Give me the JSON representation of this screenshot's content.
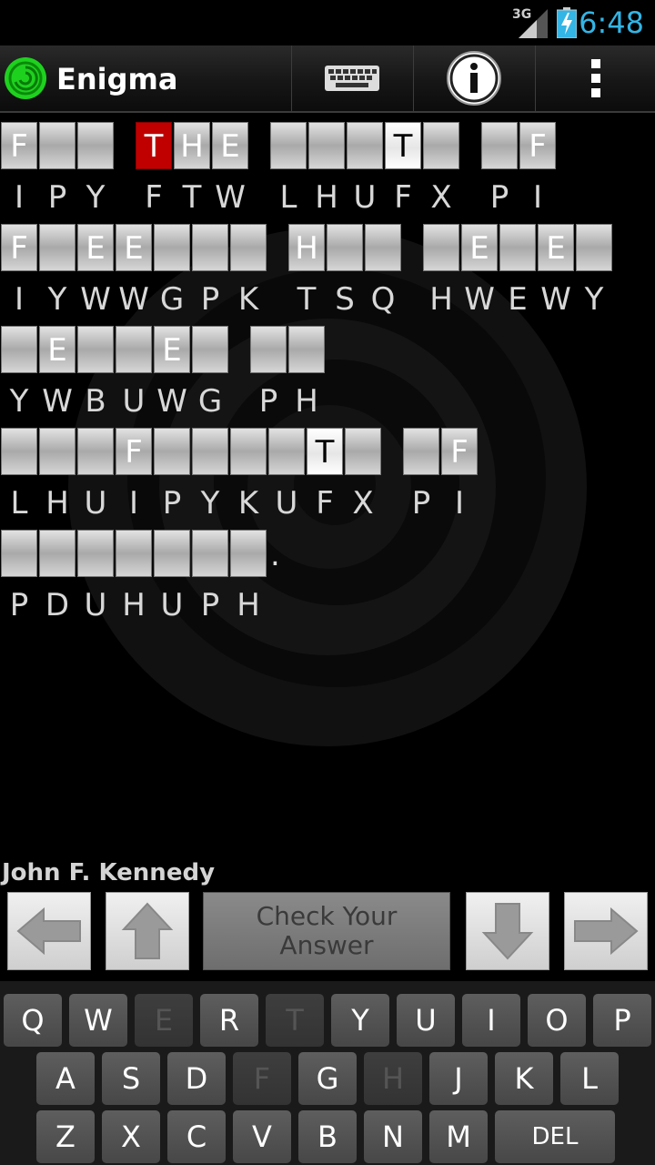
{
  "status_bar": {
    "network": "3G",
    "time": "6:48"
  },
  "action_bar": {
    "title": "Enigma",
    "keyboard_icon": "keyboard-icon",
    "info_icon": "info-icon",
    "overflow_icon": "overflow-menu-icon"
  },
  "puzzle": {
    "lines": [
      {
        "words": [
          {
            "slots": [
              {
                "l": "F",
                "c": "I"
              },
              {
                "l": "",
                "c": "P"
              },
              {
                "l": "",
                "c": "Y"
              }
            ]
          },
          {
            "slots": [
              {
                "l": "T",
                "c": "F",
                "state": "selected"
              },
              {
                "l": "H",
                "c": "T"
              },
              {
                "l": "E",
                "c": "W"
              }
            ]
          },
          {
            "slots": [
              {
                "l": "",
                "c": "L"
              },
              {
                "l": "",
                "c": "H"
              },
              {
                "l": "",
                "c": "U"
              },
              {
                "l": "T",
                "c": "F",
                "state": "current"
              },
              {
                "l": "",
                "c": "X"
              }
            ]
          },
          {
            "slots": [
              {
                "l": "",
                "c": "P"
              },
              {
                "l": "F",
                "c": "I"
              }
            ]
          }
        ]
      },
      {
        "words": [
          {
            "slots": [
              {
                "l": "F",
                "c": "I"
              },
              {
                "l": "",
                "c": "Y"
              },
              {
                "l": "E",
                "c": "W"
              },
              {
                "l": "E",
                "c": "W"
              },
              {
                "l": "",
                "c": "G"
              },
              {
                "l": "",
                "c": "P"
              },
              {
                "l": "",
                "c": "K"
              }
            ]
          },
          {
            "slots": [
              {
                "l": "H",
                "c": "T"
              },
              {
                "l": "",
                "c": "S"
              },
              {
                "l": "",
                "c": "Q"
              }
            ]
          },
          {
            "slots": [
              {
                "l": "",
                "c": "H"
              },
              {
                "l": "E",
                "c": "W"
              },
              {
                "l": "",
                "c": "E"
              },
              {
                "l": "E",
                "c": "W"
              },
              {
                "l": "",
                "c": "Y"
              }
            ]
          }
        ]
      },
      {
        "words": [
          {
            "slots": [
              {
                "l": "",
                "c": "Y"
              },
              {
                "l": "E",
                "c": "W"
              },
              {
                "l": "",
                "c": "B"
              },
              {
                "l": "",
                "c": "U"
              },
              {
                "l": "E",
                "c": "W"
              },
              {
                "l": "",
                "c": "G"
              }
            ]
          },
          {
            "slots": [
              {
                "l": "",
                "c": "P"
              },
              {
                "l": "",
                "c": "H"
              }
            ]
          }
        ]
      },
      {
        "words": [
          {
            "slots": [
              {
                "l": "",
                "c": "L"
              },
              {
                "l": "",
                "c": "H"
              },
              {
                "l": "",
                "c": "U"
              },
              {
                "l": "F",
                "c": "I"
              },
              {
                "l": "",
                "c": "P"
              },
              {
                "l": "",
                "c": "Y"
              },
              {
                "l": "",
                "c": "K"
              },
              {
                "l": "",
                "c": "U"
              },
              {
                "l": "T",
                "c": "F",
                "state": "current"
              },
              {
                "l": "",
                "c": "X"
              }
            ]
          },
          {
            "slots": [
              {
                "l": "",
                "c": "P"
              },
              {
                "l": "F",
                "c": "I"
              }
            ]
          }
        ]
      },
      {
        "words": [
          {
            "slots": [
              {
                "l": "",
                "c": "P"
              },
              {
                "l": "",
                "c": "D"
              },
              {
                "l": "",
                "c": "U"
              },
              {
                "l": "",
                "c": "H"
              },
              {
                "l": "",
                "c": "U"
              },
              {
                "l": "",
                "c": "P"
              },
              {
                "l": "",
                "c": "H"
              }
            ],
            "trail": "."
          }
        ]
      }
    ]
  },
  "author": "John F. Kennedy",
  "controls": {
    "left_icon": "arrow-left-icon",
    "up_icon": "arrow-up-icon",
    "check_line1": "Check Your",
    "check_line2": "Answer",
    "down_icon": "arrow-down-icon",
    "right_icon": "arrow-right-icon"
  },
  "keyboard": {
    "rows": [
      [
        {
          "k": "Q"
        },
        {
          "k": "W"
        },
        {
          "k": "E",
          "used": true
        },
        {
          "k": "R"
        },
        {
          "k": "T",
          "used": true
        },
        {
          "k": "Y"
        },
        {
          "k": "U"
        },
        {
          "k": "I"
        },
        {
          "k": "O"
        },
        {
          "k": "P"
        }
      ],
      [
        {
          "k": "A"
        },
        {
          "k": "S"
        },
        {
          "k": "D"
        },
        {
          "k": "F",
          "used": true
        },
        {
          "k": "G"
        },
        {
          "k": "H",
          "used": true
        },
        {
          "k": "J"
        },
        {
          "k": "K"
        },
        {
          "k": "L"
        }
      ],
      [
        {
          "k": "Z"
        },
        {
          "k": "X"
        },
        {
          "k": "C"
        },
        {
          "k": "V"
        },
        {
          "k": "B"
        },
        {
          "k": "N"
        },
        {
          "k": "M"
        },
        {
          "k": "DEL",
          "wide": true
        }
      ]
    ]
  }
}
